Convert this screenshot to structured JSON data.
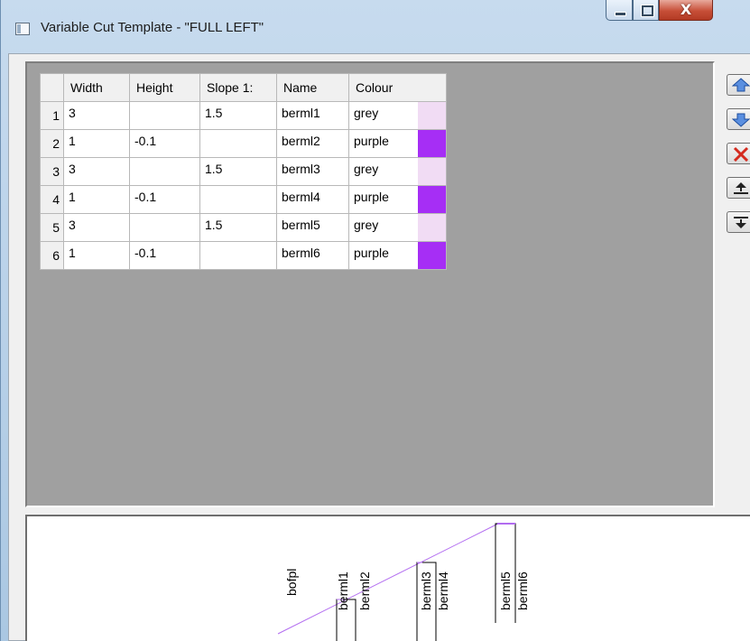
{
  "window": {
    "title": "Variable Cut Template - \"FULL LEFT\"",
    "close_glyph": "X"
  },
  "grid": {
    "columns": [
      "Width",
      "Height",
      "Slope 1:",
      "Name",
      "Colour"
    ],
    "rows": [
      {
        "num": "1",
        "width": "3",
        "height": "",
        "slope": "1.5",
        "name": "berml1",
        "colour": "grey",
        "swatch": "#f1dcf4"
      },
      {
        "num": "2",
        "width": "1",
        "height": "-0.1",
        "slope": "",
        "name": "berml2",
        "colour": "purple",
        "swatch": "#a62ef5"
      },
      {
        "num": "3",
        "width": "3",
        "height": "",
        "slope": "1.5",
        "name": "berml3",
        "colour": "grey",
        "swatch": "#f1dcf4"
      },
      {
        "num": "4",
        "width": "1",
        "height": "-0.1",
        "slope": "",
        "name": "berml4",
        "colour": "purple",
        "swatch": "#a62ef5"
      },
      {
        "num": "5",
        "width": "3",
        "height": "",
        "slope": "1.5",
        "name": "berml5",
        "colour": "grey",
        "swatch": "#f1dcf4"
      },
      {
        "num": "6",
        "width": "1",
        "height": "-0.1",
        "slope": "",
        "name": "berml6",
        "colour": "purple",
        "swatch": "#a62ef5"
      }
    ]
  },
  "side_buttons": [
    {
      "name": "move-up-button",
      "icon": "arrow-up-icon"
    },
    {
      "name": "move-down-button",
      "icon": "arrow-down-icon"
    },
    {
      "name": "delete-row-button",
      "icon": "delete-x-icon"
    },
    {
      "name": "insert-above-button",
      "icon": "insert-above-icon"
    },
    {
      "name": "insert-below-button",
      "icon": "insert-below-icon"
    }
  ],
  "preview": {
    "labels": [
      "bofpl",
      "berml1",
      "berml2",
      "berml3",
      "berml4",
      "berml5",
      "berml6"
    ],
    "line_color": "#b26cf0",
    "bracket_color": "#000000"
  }
}
